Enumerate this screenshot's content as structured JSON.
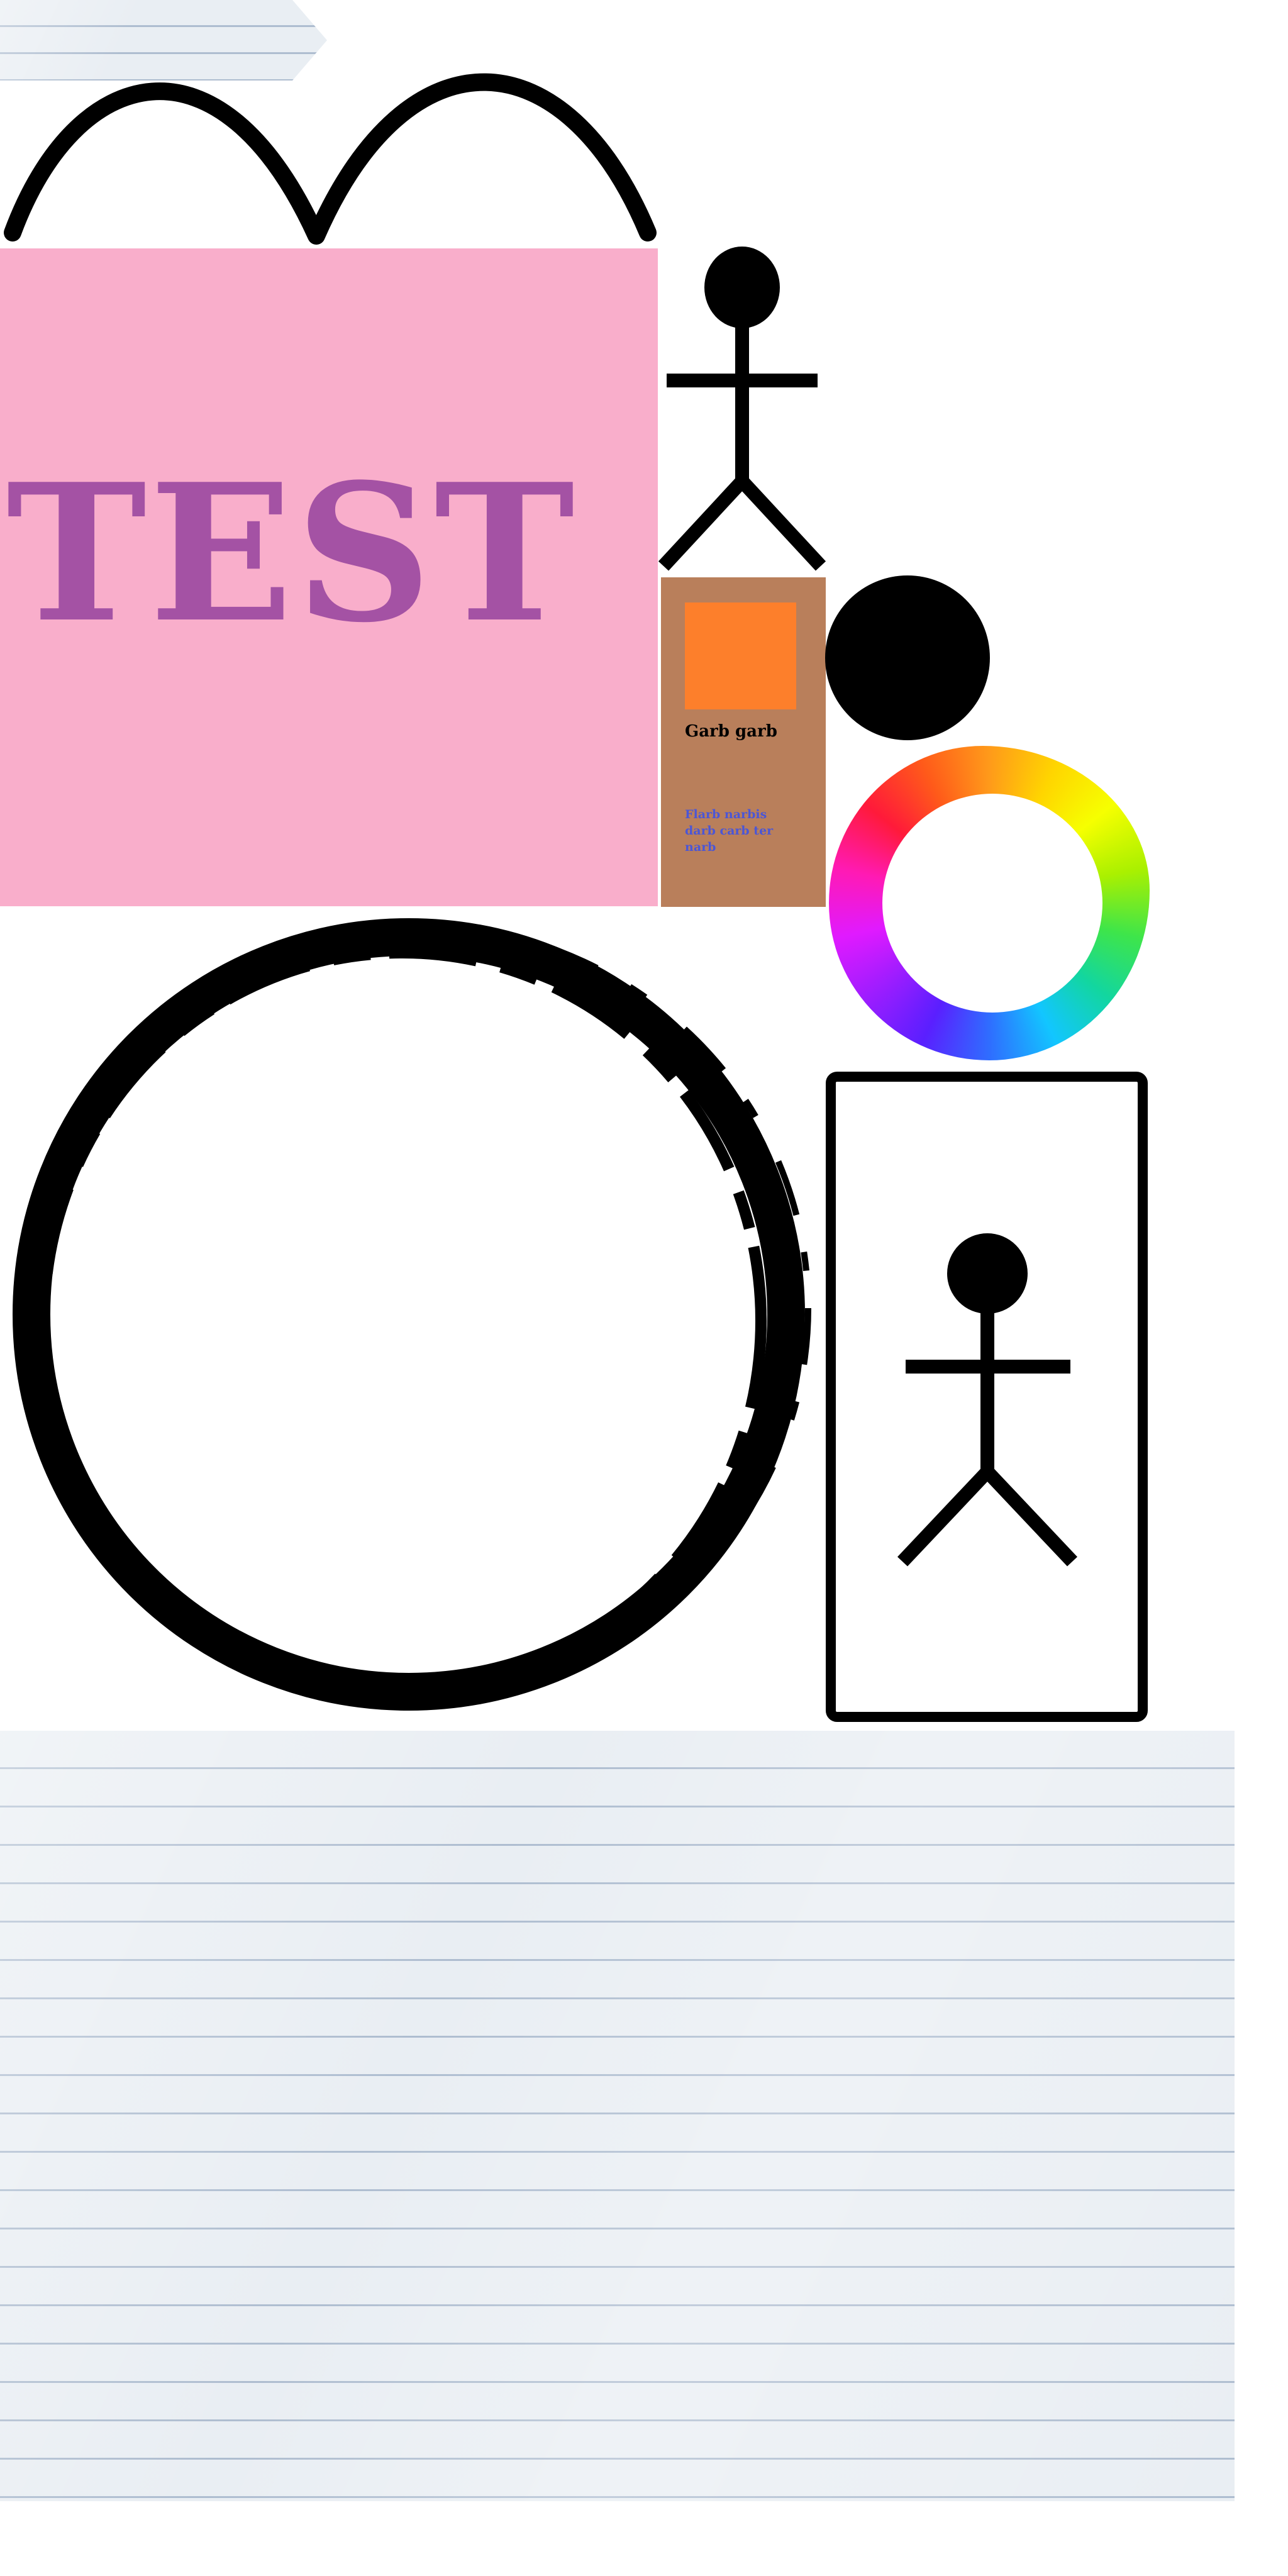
{
  "pink_card": {
    "title": "TEST",
    "background_color": "#f9aecb",
    "title_color": "#a452a4"
  },
  "brown_card": {
    "heading": "Garb garb",
    "body_text": "Flarb narbis darb carb ter narb",
    "background_color": "#b97f5b",
    "swatch_color": "#fd7f2b",
    "body_text_color": "#4b56d6"
  },
  "icons": {
    "arches": "double-arch-icon",
    "figure_top": "stick-figure-icon",
    "figure_card": "stick-figure-icon",
    "dot": "black-circle-icon",
    "wheel": "color-wheel-icon",
    "brush_ring": "brush-circle-icon"
  },
  "paper": {
    "background_color": "#e9eef3",
    "line_color": "#aebdd0"
  }
}
